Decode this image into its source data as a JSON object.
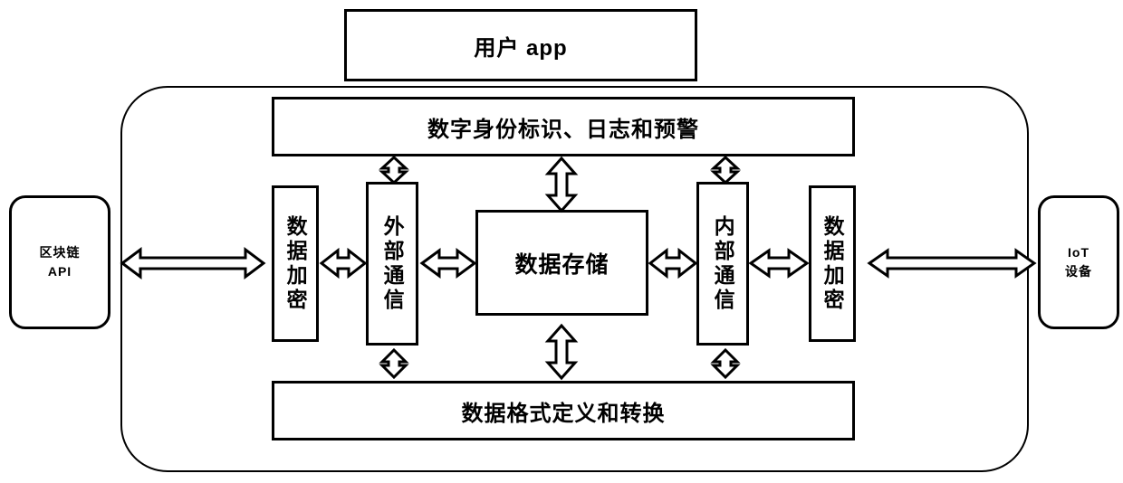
{
  "diagram": {
    "title_box": {
      "label": "用户 app"
    },
    "banners": [
      {
        "id": "identity-log-alert",
        "label": "数字身份标识、日志和预警"
      },
      {
        "id": "data-format",
        "label": "数据格式定义和转换"
      }
    ],
    "external": {
      "left": {
        "id": "blockchain-api",
        "line1": "区块链",
        "line2": "API"
      },
      "right": {
        "id": "iot-device",
        "line1": "IoT",
        "line2": "设备"
      }
    },
    "columns": [
      {
        "id": "data-encryption-left",
        "label": "数据加密"
      },
      {
        "id": "external-communication",
        "label": "外部通信"
      },
      {
        "id": "data-storage",
        "label": "数据存储"
      },
      {
        "id": "internal-communication",
        "label": "内部通信"
      },
      {
        "id": "data-encryption-right",
        "label": "数据加密"
      }
    ],
    "connectors": [
      {
        "id": "blockchain-to-encryption",
        "direction": "bidirectional",
        "orientation": "horizontal"
      },
      {
        "id": "encryption-to-external-comm",
        "direction": "bidirectional",
        "orientation": "horizontal"
      },
      {
        "id": "external-comm-to-storage",
        "direction": "bidirectional",
        "orientation": "horizontal"
      },
      {
        "id": "storage-to-internal-comm",
        "direction": "bidirectional",
        "orientation": "horizontal"
      },
      {
        "id": "internal-comm-to-encryption",
        "direction": "bidirectional",
        "orientation": "horizontal"
      },
      {
        "id": "encryption-to-iot",
        "direction": "bidirectional",
        "orientation": "horizontal"
      },
      {
        "id": "external-comm-to-identity",
        "direction": "bidirectional",
        "orientation": "vertical"
      },
      {
        "id": "storage-to-identity",
        "direction": "bidirectional",
        "orientation": "vertical"
      },
      {
        "id": "internal-comm-to-identity",
        "direction": "bidirectional",
        "orientation": "vertical"
      },
      {
        "id": "external-comm-to-format",
        "direction": "bidirectional",
        "orientation": "vertical"
      },
      {
        "id": "storage-to-format",
        "direction": "bidirectional",
        "orientation": "vertical"
      },
      {
        "id": "internal-comm-to-format",
        "direction": "bidirectional",
        "orientation": "vertical"
      }
    ],
    "colors": {
      "stroke": "#000000",
      "fill": "#ffffff",
      "background": "#ffffff"
    }
  }
}
